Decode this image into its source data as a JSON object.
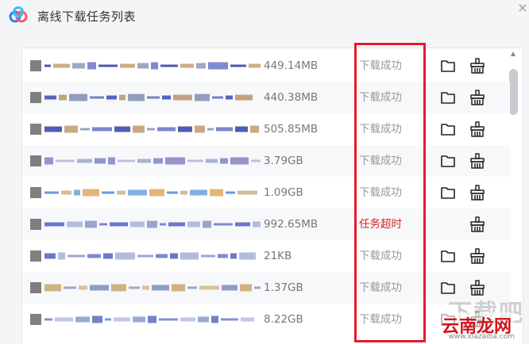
{
  "window": {
    "title": "离线下载任务列表",
    "close_glyph": "×"
  },
  "tasks": [
    {
      "size": "449.14MB",
      "status": "下载成功",
      "status_type": "success",
      "has_folder": true
    },
    {
      "size": "440.38MB",
      "status": "下载成功",
      "status_type": "success",
      "has_folder": true
    },
    {
      "size": "505.85MB",
      "status": "下载成功",
      "status_type": "success",
      "has_folder": true
    },
    {
      "size": "3.79GB",
      "status": "下载成功",
      "status_type": "success",
      "has_folder": true
    },
    {
      "size": "1.09GB",
      "status": "下载成功",
      "status_type": "success",
      "has_folder": true
    },
    {
      "size": "992.65MB",
      "status": "任务超时",
      "status_type": "timeout",
      "has_folder": false
    },
    {
      "size": "21KB",
      "status": "下载成功",
      "status_type": "success",
      "has_folder": true
    },
    {
      "size": "1.37GB",
      "status": "下载成功",
      "status_type": "success",
      "has_folder": true
    },
    {
      "size": "8.22GB",
      "status": "下载成功",
      "status_type": "success",
      "has_folder": true
    }
  ],
  "icons": {
    "logo": "baidu-netdisk-logo-icon",
    "folder": "folder-icon",
    "clean": "clean-brush-icon"
  },
  "colors": {
    "accent": "#e8192c",
    "timeout": "#e02020",
    "status_text": "#999999",
    "logo_blue": "#2e7cf6"
  },
  "watermark": {
    "ghost": "下载吧",
    "main": "云南龙网",
    "url": "www.xiazaiba.com"
  }
}
